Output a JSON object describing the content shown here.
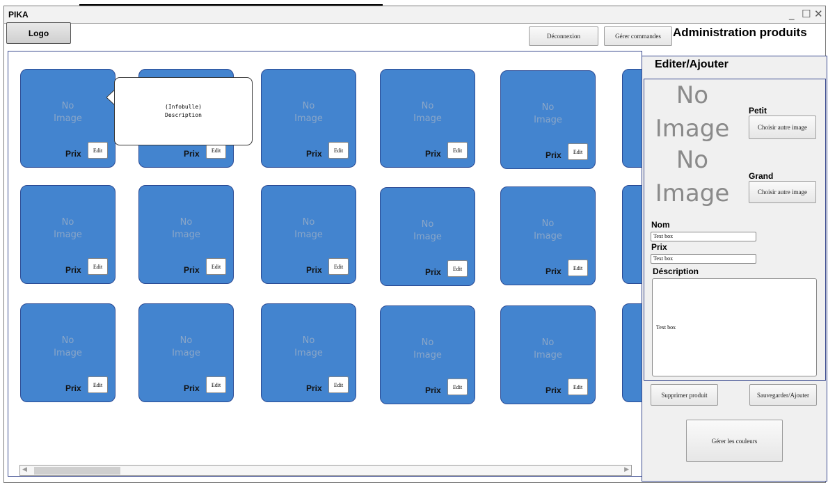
{
  "window": {
    "title": "PIKA",
    "min_icon": "_",
    "max_icon": "☐",
    "close_icon": "✕"
  },
  "header": {
    "logo_label": "Logo",
    "logout_label": "Déconnexion",
    "orders_label": "Gérer commandes",
    "page_title": "Administration produits"
  },
  "grid": {
    "no_image_line1": "No",
    "no_image_line2": "Image",
    "price_label": "Prix",
    "edit_label": "Edit",
    "tooltip_line1": "(Infobulle)",
    "tooltip_line2": "Description"
  },
  "editor": {
    "title": "Editer/Ajouter",
    "no_image_line1": "No",
    "no_image_line2": "Image",
    "small_label": "Petit",
    "large_label": "Grand",
    "choose_image_label": "Choisir autre image",
    "name_label": "Nom",
    "name_value": "Text box",
    "price_label": "Prix",
    "price_value": "Text box",
    "description_label": "Déscription",
    "description_value": "Text box",
    "delete_label": "Supprimer produit",
    "save_label": "Sauvegarder/Ajouter",
    "colors_label": "Gérer les couleurs"
  },
  "colors": {
    "card_fill": "#4384cf",
    "card_border": "#2a4a94",
    "panel_border": "#3b4b8f"
  }
}
